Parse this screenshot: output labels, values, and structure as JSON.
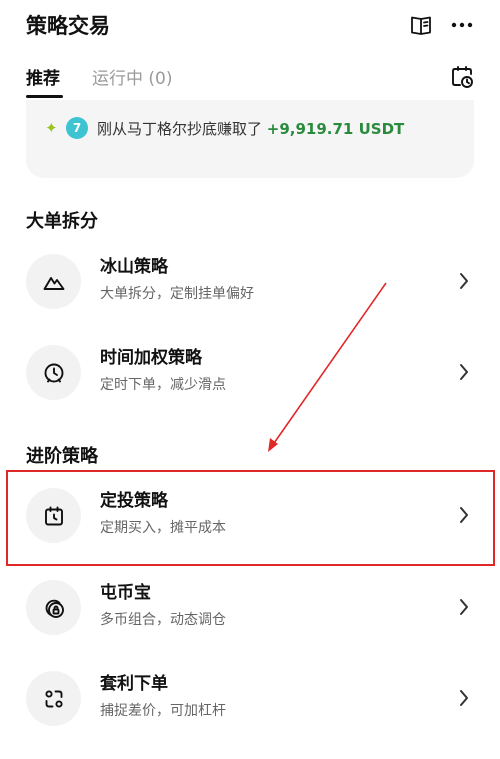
{
  "header": {
    "title": "策略交易",
    "icons": [
      "book-icon",
      "more-icon"
    ]
  },
  "tabs": [
    {
      "label": "推荐",
      "active": true
    },
    {
      "label": "运行中 (0)",
      "active": false
    }
  ],
  "banner": {
    "sparkle": "✦",
    "badge": "7",
    "text": "刚从马丁格尔抄底赚取了 ",
    "amount": "+9,919.71 USDT"
  },
  "sections": [
    {
      "title": "大单拆分",
      "items": [
        {
          "title": "冰山策略",
          "subtitle": "大单拆分，定制挂单偏好",
          "icon": "mountain-icon"
        },
        {
          "title": "时间加权策略",
          "subtitle": "定时下单，减少滑点",
          "icon": "alarm-clock-icon"
        }
      ]
    },
    {
      "title": "进阶策略",
      "items": [
        {
          "title": "定投策略",
          "subtitle": "定期买入，摊平成本",
          "icon": "calendar-clock-icon"
        },
        {
          "title": "屯币宝",
          "subtitle": "多币组合，动态调仓",
          "icon": "coins-lock-icon"
        },
        {
          "title": "套利下单",
          "subtitle": "捕捉差价，可加杠杆",
          "icon": "arbitrage-icon"
        }
      ]
    }
  ],
  "colors": {
    "accent_green": "#2a8a3e",
    "highlight_red": "#e02828",
    "badge_cyan": "#3ec3d3"
  }
}
